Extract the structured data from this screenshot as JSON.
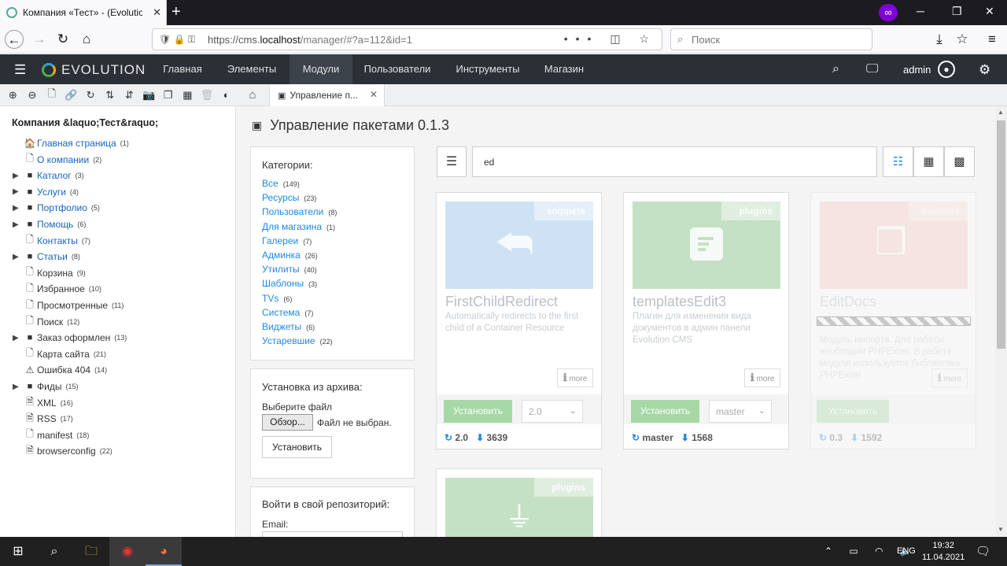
{
  "browser": {
    "tab_title": "Компания «Тест» - (Evolution",
    "url_prefix": "https://cms.",
    "url_host": "localhost",
    "url_path": "/manager/#?a=112&id=1",
    "search_placeholder": "Поиск"
  },
  "app": {
    "logo": "EVOLUTION",
    "menu": [
      "Главная",
      "Элементы",
      "Модули",
      "Пользователи",
      "Инструменты",
      "Магазин"
    ],
    "active_menu": "Модули",
    "user": "admin"
  },
  "tree": {
    "site_name": "Компания &laquo;Тест&raquo;",
    "items": [
      {
        "label": "Главная страница",
        "count": "(1)",
        "icon": "home-icon",
        "folder": false,
        "link": true
      },
      {
        "label": "О компании",
        "count": "(2)",
        "icon": "page-icon",
        "folder": false,
        "link": true
      },
      {
        "label": "Каталог",
        "count": "(3)",
        "icon": "folder-icon",
        "folder": true,
        "link": true
      },
      {
        "label": "Услуги",
        "count": "(4)",
        "icon": "folder-icon",
        "folder": true,
        "link": true
      },
      {
        "label": "Портфолио",
        "count": "(5)",
        "icon": "folder-icon",
        "folder": true,
        "link": true
      },
      {
        "label": "Помощь",
        "count": "(6)",
        "icon": "folder-icon",
        "folder": true,
        "link": true
      },
      {
        "label": "Контакты",
        "count": "(7)",
        "icon": "page-icon",
        "folder": false,
        "link": true
      },
      {
        "label": "Статьи",
        "count": "(8)",
        "icon": "folder-icon",
        "folder": true,
        "link": true
      },
      {
        "label": "Корзина",
        "count": "(9)",
        "icon": "page-icon",
        "folder": false,
        "link": false
      },
      {
        "label": "Избранное",
        "count": "(10)",
        "icon": "page-icon",
        "folder": false,
        "link": false
      },
      {
        "label": "Просмотренные",
        "count": "(11)",
        "icon": "page-icon",
        "folder": false,
        "link": false
      },
      {
        "label": "Поиск",
        "count": "(12)",
        "icon": "page-icon",
        "folder": false,
        "link": false
      },
      {
        "label": "Заказ оформлен",
        "count": "(13)",
        "icon": "folder-icon",
        "folder": true,
        "link": false
      },
      {
        "label": "Карта сайта",
        "count": "(21)",
        "icon": "page-icon",
        "folder": false,
        "link": false
      },
      {
        "label": "Ошибка 404",
        "count": "(14)",
        "icon": "warning-icon",
        "folder": false,
        "link": false
      },
      {
        "label": "Фиды",
        "count": "(15)",
        "icon": "folder-icon",
        "folder": true,
        "link": false
      },
      {
        "label": "XML",
        "count": "(16)",
        "icon": "code-file-icon",
        "folder": false,
        "link": false
      },
      {
        "label": "RSS",
        "count": "(17)",
        "icon": "code-file-icon",
        "folder": false,
        "link": false
      },
      {
        "label": "manifest",
        "count": "(18)",
        "icon": "page-icon",
        "folder": false,
        "link": false
      },
      {
        "label": "browserconfig",
        "count": "(22)",
        "icon": "code-file-icon",
        "folder": false,
        "link": false
      }
    ]
  },
  "content_tab": "Управление п...",
  "page_title": "Управление пакетами 0.1.3",
  "categories": {
    "heading": "Категории:",
    "items": [
      {
        "label": "Все",
        "count": "(149)"
      },
      {
        "label": "Ресурсы",
        "count": "(23)"
      },
      {
        "label": "Пользователи",
        "count": "(8)"
      },
      {
        "label": "Для магазина",
        "count": "(1)"
      },
      {
        "label": "Галереи",
        "count": "(7)"
      },
      {
        "label": "Админка",
        "count": "(26)"
      },
      {
        "label": "Утилиты",
        "count": "(40)"
      },
      {
        "label": "Шаблоны",
        "count": "(3)"
      },
      {
        "label": "TVs",
        "count": "(6)"
      },
      {
        "label": "Система",
        "count": "(7)"
      },
      {
        "label": "Виджеты",
        "count": "(6)"
      },
      {
        "label": "Устаревшие",
        "count": "(22)"
      }
    ]
  },
  "archive": {
    "heading": "Установка из архива:",
    "file_label": "Выберите файл",
    "browse": "Обзор...",
    "no_file": "Файл не выбран.",
    "install": "Установить"
  },
  "login": {
    "heading": "Войти в свой репозиторий:",
    "email_label": "Email:"
  },
  "filter": {
    "value": "ed"
  },
  "cards": [
    {
      "tag": "snippets",
      "title": "FirstChildRedirect",
      "desc": "Automatically redirects to the first child of a Container Resource",
      "more": "more",
      "install": "Установить",
      "version": "2.0",
      "stat_version": "2.0",
      "downloads": "3639",
      "color": "#cfe2f3"
    },
    {
      "tag": "plugins",
      "title": "templatesEdit3",
      "desc": "Плагин для изменения вида документов в админ панели Evolution CMS",
      "more": "more",
      "install": "Установить",
      "version": "master",
      "stat_version": "master",
      "downloads": "1568",
      "color": "#c5e1c5"
    },
    {
      "tag": "modules",
      "title": "EditDocs",
      "desc": "Модуль импорта. Для работы необходим PHPExcel. В работе модуля используется библиотека PHPExcel",
      "more": "more",
      "install": "Установить",
      "version": "",
      "stat_version": "0.3",
      "downloads": "1592",
      "color": "#f9c9c0",
      "progress": 1.0
    },
    {
      "tag": "plugins",
      "color": "#c5e1c5"
    }
  ],
  "taskbar": {
    "lang": "ENG",
    "time": "19:32",
    "date": "11.04.2021"
  }
}
